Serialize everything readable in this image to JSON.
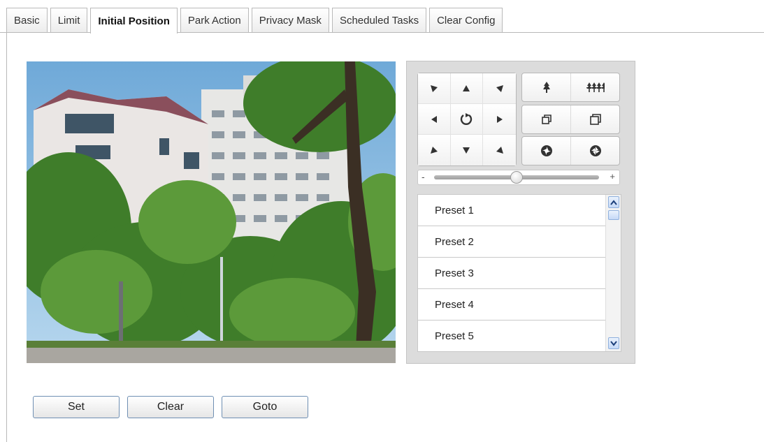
{
  "tabs": [
    {
      "label": "Basic",
      "active": false
    },
    {
      "label": "Limit",
      "active": false
    },
    {
      "label": "Initial Position",
      "active": true
    },
    {
      "label": "Park Action",
      "active": false
    },
    {
      "label": "Privacy Mask",
      "active": false
    },
    {
      "label": "Scheduled Tasks",
      "active": false
    },
    {
      "label": "Clear Config",
      "active": false
    }
  ],
  "ptz": {
    "directions": [
      "up-left-icon",
      "up-icon",
      "up-right-icon",
      "left-icon",
      "auto-rotate-icon",
      "right-icon",
      "down-left-icon",
      "down-icon",
      "down-right-icon"
    ],
    "zoom_icons": [
      "zoom-in-icon",
      "zoom-out-icon"
    ],
    "focus_icons": [
      "focus-near-icon",
      "focus-far-icon"
    ],
    "iris_icons": [
      "iris-open-icon",
      "iris-close-icon"
    ],
    "speed": {
      "minus": "-",
      "plus": "+",
      "level": 0.5
    }
  },
  "presets": [
    "Preset 1",
    "Preset 2",
    "Preset 3",
    "Preset 4",
    "Preset 5"
  ],
  "buttons": {
    "set": "Set",
    "clear": "Clear",
    "goto": "Goto"
  },
  "colors": {
    "tab_border": "#b9b9b9",
    "button_border": "#6f8fb3",
    "panel_bg": "#dcdcdc"
  }
}
